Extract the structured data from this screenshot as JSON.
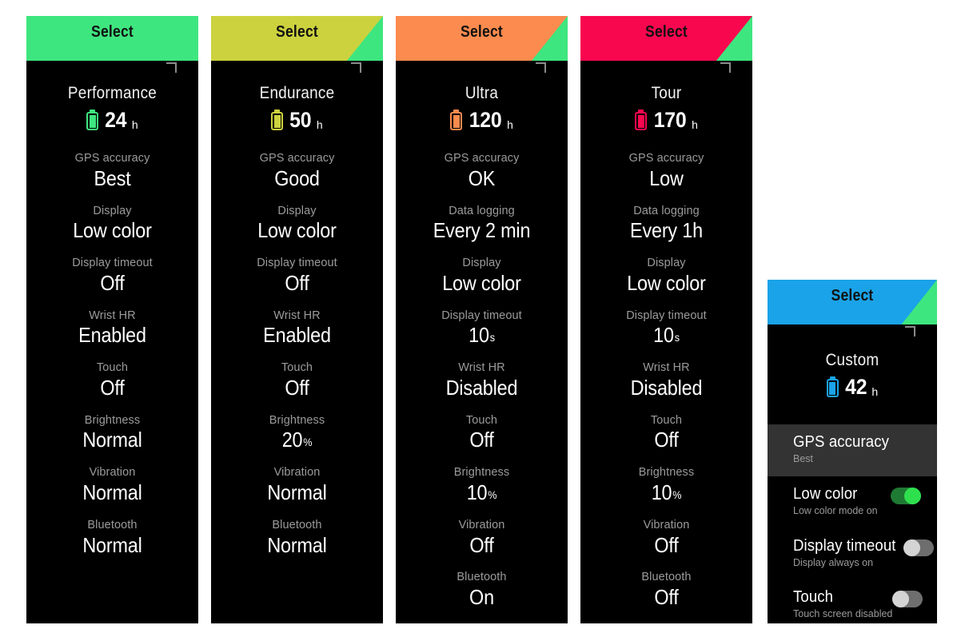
{
  "app": {
    "title": "Battery mode selection screens",
    "header_label": "Select",
    "background": "#ffffff"
  },
  "panels": [
    {
      "id": "performance",
      "header_label": "Select",
      "accent": "#3ee67f",
      "mode_name": "Performance",
      "battery_value": "24",
      "battery_unit": "h",
      "settings": [
        {
          "label": "GPS accuracy",
          "value": "Best",
          "unit": ""
        },
        {
          "label": "Display",
          "value": "Low color",
          "unit": ""
        },
        {
          "label": "Display timeout",
          "value": "Off",
          "unit": ""
        },
        {
          "label": "Wrist HR",
          "value": "Enabled",
          "unit": ""
        },
        {
          "label": "Touch",
          "value": "Off",
          "unit": ""
        },
        {
          "label": "Brightness",
          "value": "Normal",
          "unit": ""
        },
        {
          "label": "Vibration",
          "value": "Normal",
          "unit": ""
        },
        {
          "label": "Bluetooth",
          "value": "Normal",
          "unit": ""
        }
      ]
    },
    {
      "id": "endurance",
      "header_label": "Select",
      "accent": "#ccd23e",
      "mode_name": "Endurance",
      "battery_value": "50",
      "battery_unit": "h",
      "settings": [
        {
          "label": "GPS accuracy",
          "value": "Good",
          "unit": ""
        },
        {
          "label": "Display",
          "value": "Low color",
          "unit": ""
        },
        {
          "label": "Display timeout",
          "value": "Off",
          "unit": ""
        },
        {
          "label": "Wrist HR",
          "value": "Enabled",
          "unit": ""
        },
        {
          "label": "Touch",
          "value": "Off",
          "unit": ""
        },
        {
          "label": "Brightness",
          "value": "20",
          "unit": "%"
        },
        {
          "label": "Vibration",
          "value": "Normal",
          "unit": ""
        },
        {
          "label": "Bluetooth",
          "value": "Normal",
          "unit": ""
        }
      ]
    },
    {
      "id": "ultra",
      "header_label": "Select",
      "accent": "#fb8b4e",
      "mode_name": "Ultra",
      "battery_value": "120",
      "battery_unit": "h",
      "settings": [
        {
          "label": "GPS accuracy",
          "value": "OK",
          "unit": ""
        },
        {
          "label": "Data logging",
          "value": "Every 2 min",
          "unit": ""
        },
        {
          "label": "Display",
          "value": "Low color",
          "unit": ""
        },
        {
          "label": "Display timeout",
          "value": "10",
          "unit": "s"
        },
        {
          "label": "Wrist HR",
          "value": "Disabled",
          "unit": ""
        },
        {
          "label": "Touch",
          "value": "Off",
          "unit": ""
        },
        {
          "label": "Brightness",
          "value": "10",
          "unit": "%"
        },
        {
          "label": "Vibration",
          "value": "Off",
          "unit": ""
        },
        {
          "label": "Bluetooth",
          "value": "On",
          "unit": ""
        }
      ]
    },
    {
      "id": "tour",
      "header_label": "Select",
      "accent": "#f8074f",
      "mode_name": "Tour",
      "battery_value": "170",
      "battery_unit": "h",
      "settings": [
        {
          "label": "GPS accuracy",
          "value": "Low",
          "unit": ""
        },
        {
          "label": "Data logging",
          "value": "Every 1h",
          "unit": ""
        },
        {
          "label": "Display",
          "value": "Low color",
          "unit": ""
        },
        {
          "label": "Display timeout",
          "value": "10",
          "unit": "s"
        },
        {
          "label": "Wrist HR",
          "value": "Disabled",
          "unit": ""
        },
        {
          "label": "Touch",
          "value": "Off",
          "unit": ""
        },
        {
          "label": "Brightness",
          "value": "10",
          "unit": "%"
        },
        {
          "label": "Vibration",
          "value": "Off",
          "unit": ""
        },
        {
          "label": "Bluetooth",
          "value": "Off",
          "unit": ""
        }
      ]
    }
  ],
  "custom_panel": {
    "id": "custom",
    "header_label": "Select",
    "accent": "#1aa3e8",
    "mode_name": "Custom",
    "battery_value": "42",
    "battery_unit": "h",
    "options": [
      {
        "title": "GPS accuracy",
        "subtitle": "Best",
        "selected": true,
        "control": "none",
        "toggle_on": false
      },
      {
        "title": "Low color",
        "subtitle": "Low color mode on",
        "selected": false,
        "control": "toggle",
        "toggle_on": true
      },
      {
        "title": "Display timeout",
        "subtitle": "Display always on",
        "selected": false,
        "control": "toggle",
        "toggle_on": false
      },
      {
        "title": "Touch",
        "subtitle": "Touch screen disabled",
        "selected": false,
        "control": "toggle",
        "toggle_on": false
      }
    ]
  }
}
